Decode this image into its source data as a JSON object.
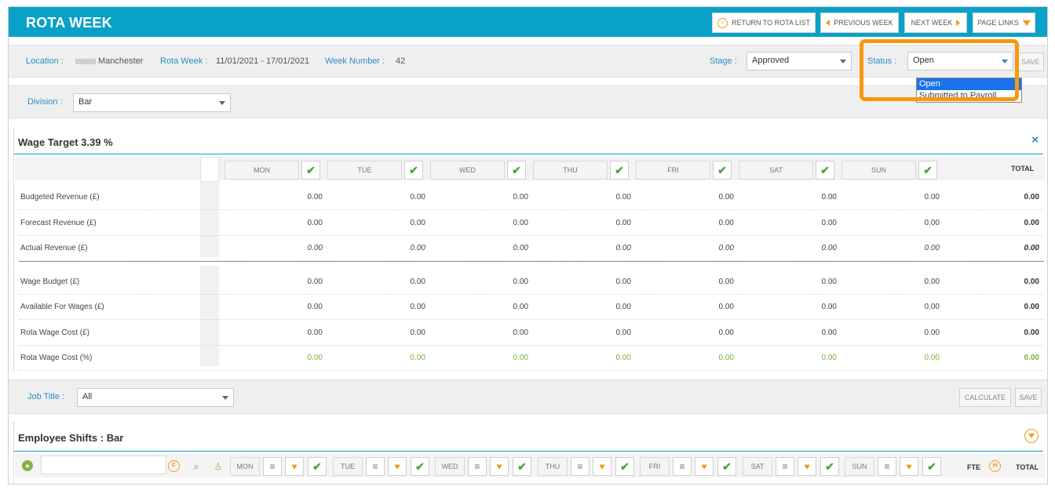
{
  "header": {
    "title": "ROTA WEEK",
    "return_label": "RETURN TO ROTA LIST",
    "prev_label": "PREVIOUS WEEK",
    "next_label": "NEXT WEEK",
    "links_label": "PAGE LINKS"
  },
  "info": {
    "location_label": "Location :",
    "location_value": "Manchester",
    "rota_week_label": "Rota Week :",
    "rota_week_value": "11/01/2021 - 17/01/2021",
    "week_number_label": "Week Number :",
    "week_number_value": "42",
    "stage_label": "Stage :",
    "stage_value": "Approved",
    "status_label": "Status :",
    "status_value": "Open",
    "save_label": "SAVE",
    "status_options": [
      "Open",
      "Submitted to Payroll"
    ]
  },
  "division": {
    "label": "Division :",
    "value": "Bar"
  },
  "wage_target": {
    "title": "Wage Target 3.39 %",
    "close": "×",
    "days": [
      "MON",
      "TUE",
      "WED",
      "THU",
      "FRI",
      "SAT",
      "SUN"
    ],
    "total_label": "TOTAL",
    "rows": [
      {
        "label": "Budgeted Revenue (£)",
        "values": [
          "0.00",
          "0.00",
          "0.00",
          "0.00",
          "0.00",
          "0.00",
          "0.00"
        ],
        "total": "0.00"
      },
      {
        "label": "Forecast Revenue (£)",
        "values": [
          "0.00",
          "0.00",
          "0.00",
          "0.00",
          "0.00",
          "0.00",
          "0.00"
        ],
        "total": "0.00"
      },
      {
        "label": "Actual Revenue (£)",
        "values": [
          "0.00",
          "0.00",
          "0.00",
          "0.00",
          "0.00",
          "0.00",
          "0.00"
        ],
        "total": "0.00"
      },
      {
        "label": "Wage Budget (£)",
        "values": [
          "0.00",
          "0.00",
          "0.00",
          "0.00",
          "0.00",
          "0.00",
          "0.00"
        ],
        "total": "0.00"
      },
      {
        "label": "Available For Wages (£)",
        "values": [
          "0.00",
          "0.00",
          "0.00",
          "0.00",
          "0.00",
          "0.00",
          "0.00"
        ],
        "total": "0.00"
      },
      {
        "label": "Rota Wage Cost (£)",
        "values": [
          "0.00",
          "0.00",
          "0.00",
          "0.00",
          "0.00",
          "0.00",
          "0.00"
        ],
        "total": "0.00"
      },
      {
        "label": "Rota Wage Cost (%)",
        "values": [
          "0.00",
          "0.00",
          "0.00",
          "0.00",
          "0.00",
          "0.00",
          "0.00"
        ],
        "total": "0.00"
      }
    ]
  },
  "job_title": {
    "label": "Job Title :",
    "value": "All",
    "calculate_label": "CALCULATE",
    "save_label": "SAVE"
  },
  "shifts": {
    "title": "Employee Shifts : Bar",
    "days": [
      "MON",
      "TUE",
      "WED",
      "THU",
      "FRI",
      "SAT",
      "SUN"
    ],
    "fte_label": "FTE",
    "h_label": "H",
    "f_label": "F",
    "total_label": "TOTAL"
  },
  "colors": {
    "header": "#0aa1c9",
    "accent": "#f29a1b",
    "check": "#4aa53c",
    "green_value": "#76b13a",
    "label": "#2d8fc0"
  }
}
